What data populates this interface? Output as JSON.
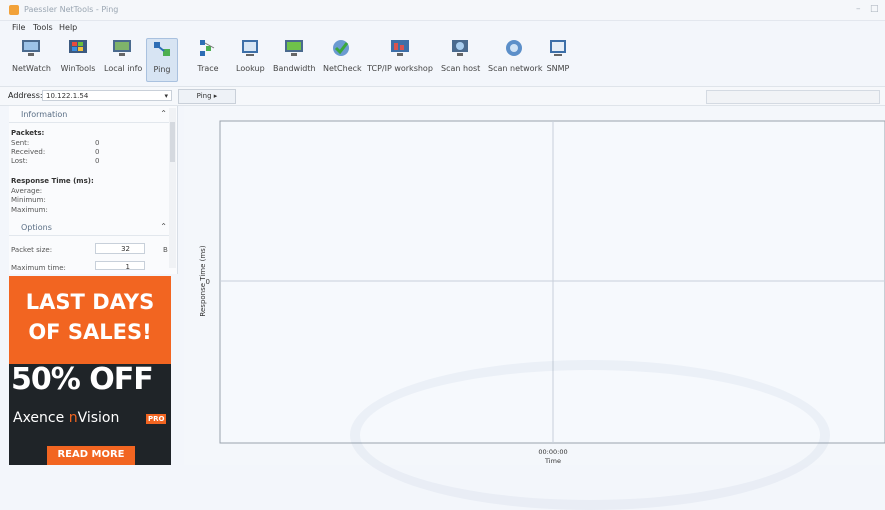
{
  "window": {
    "title": "Paessler NetTools - Ping"
  },
  "menu": [
    "File",
    "Tools",
    "Help"
  ],
  "toolbar": [
    {
      "label": "NetWatch",
      "icon": "monitor-icon"
    },
    {
      "label": "WinTools",
      "icon": "windows-icon"
    },
    {
      "label": "Local info",
      "icon": "computer-info-icon"
    },
    {
      "label": "Ping",
      "icon": "ping-icon",
      "active": true
    },
    {
      "label": "Trace",
      "icon": "trace-icon"
    },
    {
      "label": "Lookup",
      "icon": "lookup-icon"
    },
    {
      "label": "Bandwidth",
      "icon": "bandwidth-icon"
    },
    {
      "label": "NetCheck",
      "icon": "netcheck-icon"
    },
    {
      "label": "TCP/IP workshop",
      "icon": "tcpip-workshop-icon"
    },
    {
      "label": "Scan host",
      "icon": "scan-host-icon"
    },
    {
      "label": "Scan network",
      "icon": "scan-network-icon"
    },
    {
      "label": "SNMP",
      "icon": "snmp-icon"
    }
  ],
  "address": {
    "label": "Address:",
    "value": "10.122.1.54",
    "ping_button": "Ping ▸"
  },
  "information": {
    "header": "Information",
    "packets_title": "Packets:",
    "sent_label": "Sent:",
    "sent": "0",
    "received_label": "Received:",
    "received": "0",
    "lost_label": "Lost:",
    "lost": "0",
    "response_title": "Response Time (ms):",
    "average_label": "Average:",
    "minimum_label": "Minimum:",
    "maximum_label": "Maximum:"
  },
  "options": {
    "header": "Options",
    "packet_size_label": "Packet size:",
    "packet_size": "32",
    "packet_size_unit": "B",
    "max_time_label": "Maximum time:",
    "max_time": "1"
  },
  "ad": {
    "line1": "LAST DAYS",
    "line2": "OF SALES!",
    "line3": "50% OFF",
    "brand_a": "Axence ",
    "brand_b": "n",
    "brand_c": "Vision",
    "badge": "PRO",
    "cta": "READ MORE"
  },
  "chart_data": {
    "type": "line",
    "ylabel": "Response Time (ms)",
    "xlabel": "Time",
    "x": [
      "00:00:00"
    ],
    "y_ticks": [
      "0"
    ],
    "series": [],
    "grid": true
  },
  "colors": {
    "accent": "#f26521",
    "chart_bg": "#f6f9fd",
    "ad_dark": "#1f2428"
  }
}
